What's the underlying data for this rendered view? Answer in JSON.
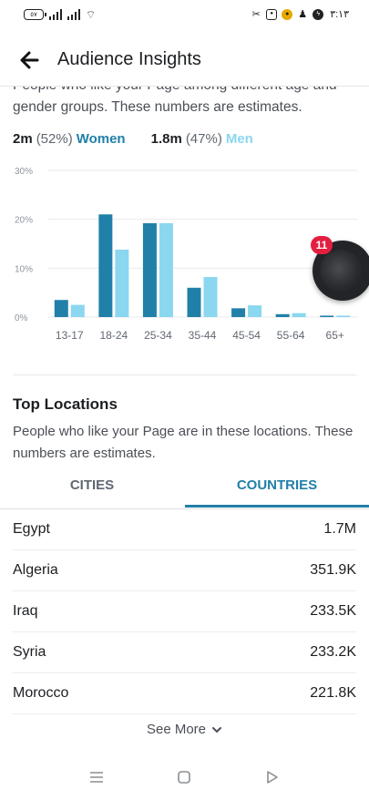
{
  "status_bar": {
    "battery_level": "٥٧",
    "time": "٣:١٣",
    "icons": [
      "battery-icon",
      "signal-icon",
      "signal-icon",
      "wifi-icon",
      "scissors-icon",
      "instagram-icon",
      "yellow-app-icon",
      "facebook-icon",
      "messenger-icon"
    ]
  },
  "header": {
    "title": "Audience Insights",
    "back_icon": "arrow-left-icon"
  },
  "intro": {
    "text": "People who like your Page among different age and gender groups. These numbers are estimates."
  },
  "gender": {
    "women_count": "2m",
    "women_pct": "(52%)",
    "women_label": "Women",
    "men_count": "1.8m",
    "men_pct": "(47%)",
    "men_label": "Men"
  },
  "colors": {
    "women": "#2180a8",
    "men": "#8ad7ef",
    "accent": "#2180a8",
    "badge": "#e41e3f"
  },
  "chart_data": {
    "type": "bar",
    "categories": [
      "13-17",
      "18-24",
      "25-34",
      "35-44",
      "45-54",
      "55-64",
      "65+"
    ],
    "series": [
      {
        "name": "Women",
        "values": [
          3.5,
          21,
          19.2,
          6,
          1.8,
          0.6,
          0.3
        ]
      },
      {
        "name": "Men",
        "values": [
          2.5,
          13.8,
          19.2,
          8.2,
          2.4,
          0.8,
          0.3
        ]
      }
    ],
    "y_ticks": [
      "0%",
      "10%",
      "20%",
      "30%"
    ],
    "ylim": [
      0,
      30
    ],
    "grid": true
  },
  "locations": {
    "title": "Top Locations",
    "description": "People who like your Page are in these locations. These numbers are estimates.",
    "tabs": [
      {
        "label": "CITIES",
        "active": false
      },
      {
        "label": "COUNTRIES",
        "active": true
      }
    ],
    "rows": [
      {
        "name": "Egypt",
        "value": "1.7M"
      },
      {
        "name": "Algeria",
        "value": "351.9K"
      },
      {
        "name": "Iraq",
        "value": "233.5K"
      },
      {
        "name": "Syria",
        "value": "233.2K"
      },
      {
        "name": "Morocco",
        "value": "221.8K"
      }
    ],
    "see_more": "See More"
  },
  "chat_head": {
    "badge": "11"
  },
  "nav_bar": {
    "icons": [
      "menu-icon",
      "home-square-icon",
      "back-triangle-icon"
    ]
  }
}
